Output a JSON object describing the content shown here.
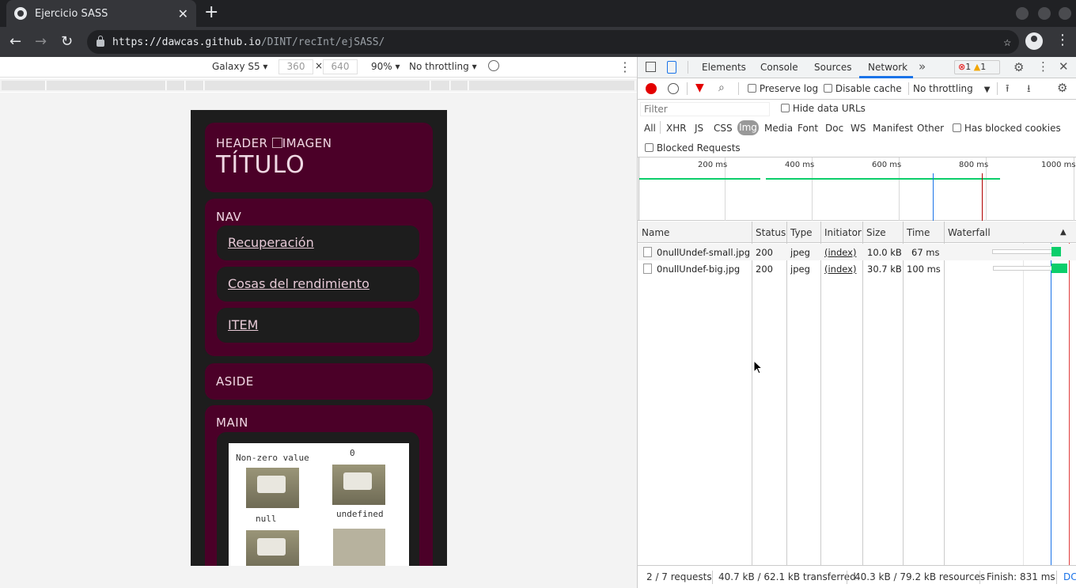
{
  "browser": {
    "tab_title": "Ejercicio SASS",
    "url_host": "https://dawcas.github.io",
    "url_path": "/DINT/recInt/ejSASS/"
  },
  "device_toolbar": {
    "device": "Galaxy S5 ▾",
    "width": "360",
    "times": "×",
    "height": "640",
    "zoom": "90% ▾",
    "throttling": "No throttling ▾"
  },
  "page": {
    "header_label": "HEADER",
    "header_img_alt": "IMAGEN",
    "title": "TÍTULO",
    "nav_label": "NAV",
    "nav_items": [
      "Recuperación",
      "Cosas del rendimiento",
      "ITEM"
    ],
    "aside_label": "ASIDE",
    "main_label": "MAIN",
    "img_captions": [
      "Non-zero value",
      "0",
      "null",
      "undefined"
    ]
  },
  "devtools": {
    "tabs": [
      "Elements",
      "Console",
      "Sources",
      "Network"
    ],
    "active_tab": "Network",
    "errors": "1",
    "warnings": "1",
    "preserve_log": "Preserve log",
    "disable_cache": "Disable cache",
    "throttling": "No throttling",
    "filter_placeholder": "Filter",
    "hide_data_urls": "Hide data URLs",
    "types": [
      "All",
      "XHR",
      "JS",
      "CSS",
      "Img",
      "Media",
      "Font",
      "Doc",
      "WS",
      "Manifest",
      "Other"
    ],
    "active_type": "Img",
    "has_blocked_cookies": "Has blocked cookies",
    "blocked_requests": "Blocked Requests",
    "timeline_ticks": [
      "200 ms",
      "400 ms",
      "600 ms",
      "800 ms",
      "1000 ms"
    ],
    "columns": [
      "Name",
      "Status",
      "Type",
      "Initiator",
      "Size",
      "Time",
      "Waterfall"
    ],
    "sort_arrow": "▲",
    "rows": [
      {
        "name": "0nullUndef-small.jpg",
        "status": "200",
        "type": "jpeg",
        "initiator": "(index)",
        "size": "10.0 kB",
        "time": "67 ms"
      },
      {
        "name": "0nullUndef-big.jpg",
        "status": "200",
        "type": "jpeg",
        "initiator": "(index)",
        "size": "30.7 kB",
        "time": "100 ms"
      }
    ],
    "status_bar": {
      "requests": "2 / 7 requests",
      "transferred": "40.7 kB / 62.1 kB transferred",
      "resources": "40.3 kB / 79.2 kB resources",
      "finish": "Finish: 831 ms",
      "dcl": "DC"
    }
  },
  "colors": {
    "accent": "#1a73e8",
    "page_box": "#4b0028",
    "waterfall_bar": "#0cce6b",
    "record": "#e30000"
  }
}
